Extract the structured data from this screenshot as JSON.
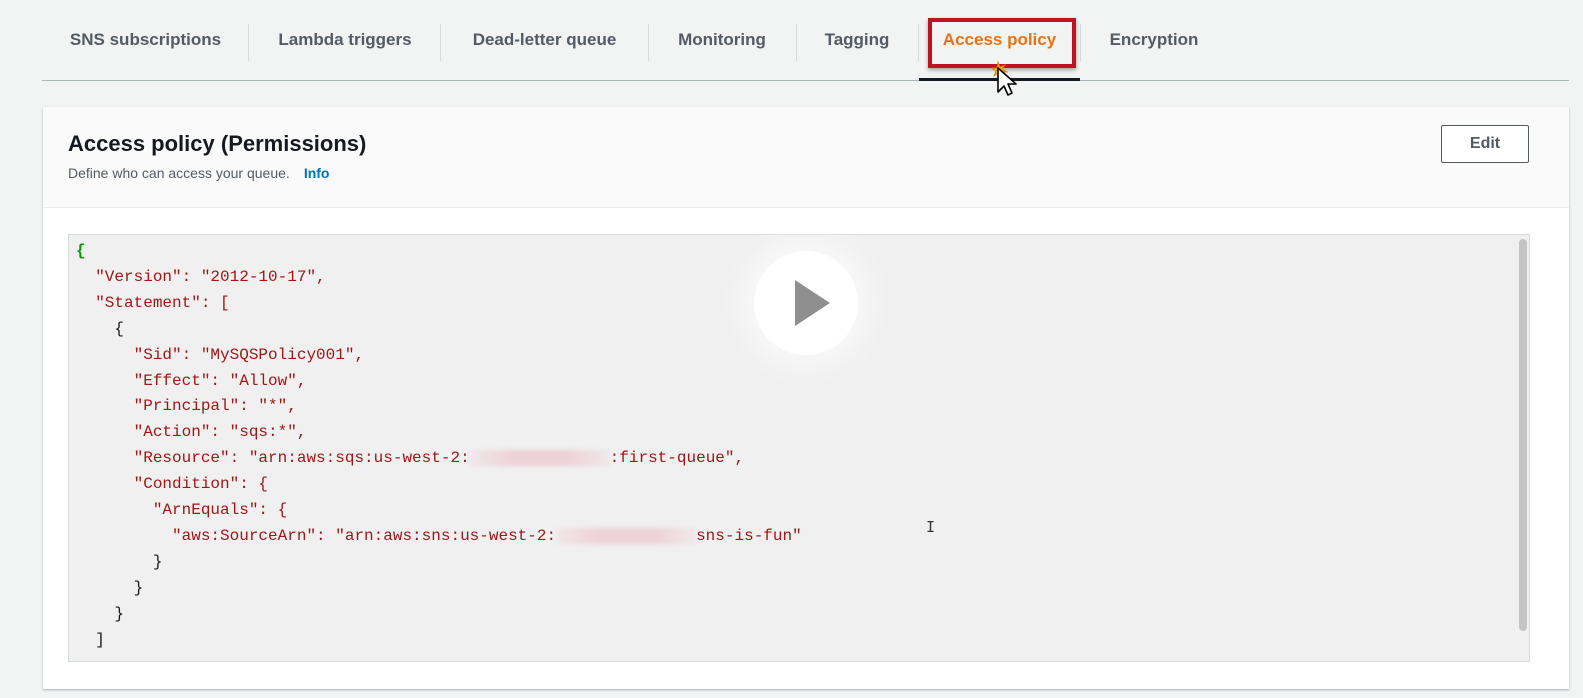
{
  "tabs": [
    {
      "label": "SNS subscriptions",
      "active": false
    },
    {
      "label": "Lambda triggers",
      "active": false
    },
    {
      "label": "Dead-letter queue",
      "active": false
    },
    {
      "label": "Monitoring",
      "active": false
    },
    {
      "label": "Tagging",
      "active": false
    },
    {
      "label": "Access policy",
      "active": true
    },
    {
      "label": "Encryption",
      "active": false
    }
  ],
  "panel": {
    "title": "Access policy (Permissions)",
    "description": "Define who can access your queue.",
    "info_link": "Info",
    "edit_label": "Edit"
  },
  "policy_lines": [
    "{",
    "  \"Version\": \"2012-10-17\",",
    "  \"Statement\": [",
    "    {",
    "      \"Sid\": \"MySQSPolicy001\",",
    "      \"Effect\": \"Allow\",",
    "      \"Principal\": \"*\",",
    "      \"Action\": \"sqs:*\",",
    "      \"Resource\": \"arn:aws:sqs:us-west-2:",
    ":first-queue\",",
    "      \"Condition\": {",
    "        \"ArnEquals\": {",
    "          \"aws:SourceArn\": \"arn:aws:sns:us-west-2:",
    "sns-is-fun\"",
    "        }",
    "      }",
    "    }",
    "  ]"
  ],
  "text_cursor_glyph": "I",
  "colors": {
    "accent_orange": "#ec7211",
    "highlight_red": "#c1121f",
    "link_blue": "#0073bb",
    "json_string": "#a31515",
    "json_root_brace": "#0a9a0a"
  },
  "icons": {
    "play": "play-icon",
    "cursor": "mouse-pointer-icon"
  }
}
